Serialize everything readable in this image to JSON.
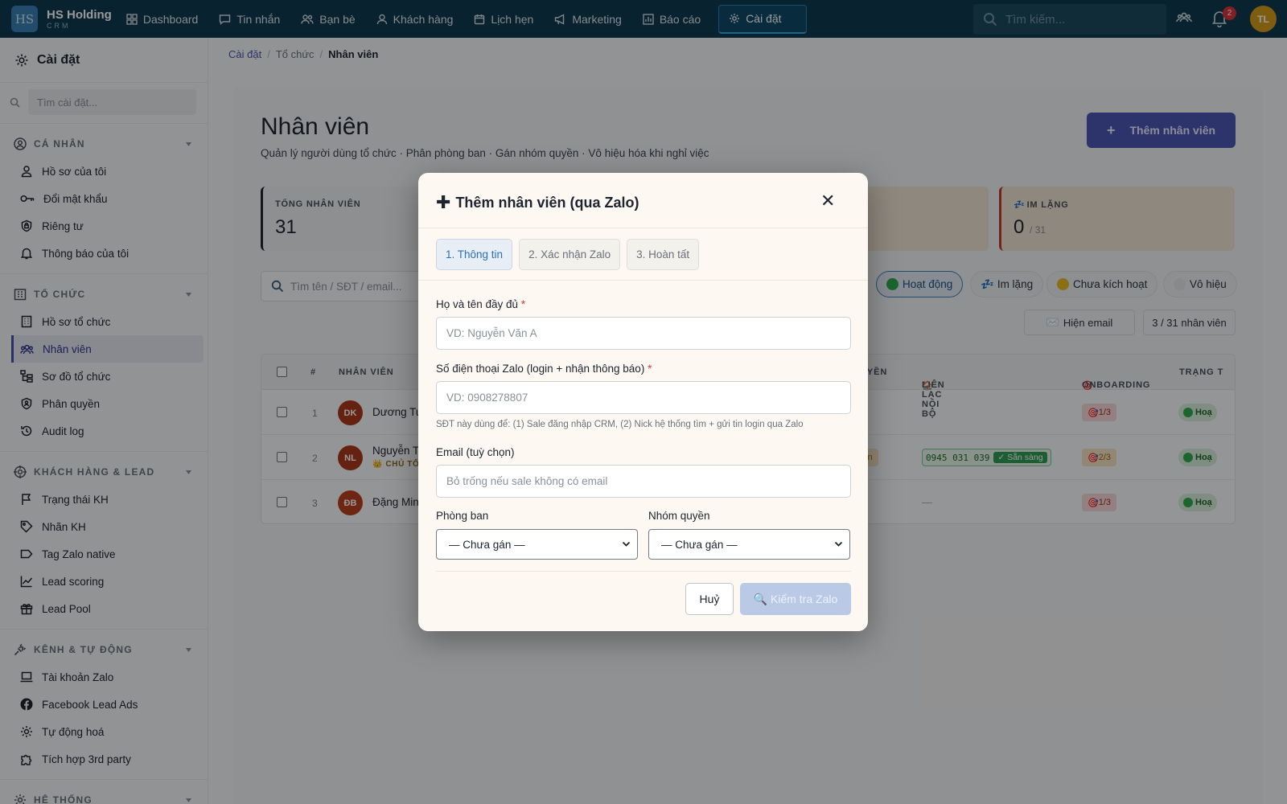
{
  "app": {
    "logo_mark": "HS",
    "name": "HS Holding",
    "sub": "CRM"
  },
  "nav": [
    {
      "label": "Dashboard",
      "icon": "grid-icon"
    },
    {
      "label": "Tin nhắn",
      "icon": "chat-icon"
    },
    {
      "label": "Bạn bè",
      "icon": "friends-icon"
    },
    {
      "label": "Khách hàng",
      "icon": "user-icon"
    },
    {
      "label": "Lịch hẹn",
      "icon": "calendar-icon"
    },
    {
      "label": "Marketing",
      "icon": "megaphone-icon"
    },
    {
      "label": "Báo cáo",
      "icon": "chart-icon"
    },
    {
      "label": "Cài đặt",
      "icon": "gear-icon",
      "active": true
    }
  ],
  "top": {
    "search_placeholder": "Tìm kiếm...",
    "notif_count": "2",
    "avatar": "TL"
  },
  "sidebar": {
    "title": "Cài đặt",
    "search_placeholder": "Tìm cài đặt...",
    "groups": [
      {
        "label": "CÁ NHÂN",
        "items": [
          "Hồ sơ của tôi",
          "Đổi mật khẩu",
          "Riêng tư",
          "Thông báo của tôi"
        ]
      },
      {
        "label": "TỔ CHỨC",
        "items": [
          "Hồ sơ tổ chức",
          "Nhân viên",
          "Sơ đồ tổ chức",
          "Phân quyền",
          "Audit log"
        ]
      },
      {
        "label": "KHÁCH HÀNG & LEAD",
        "items": [
          "Trạng thái KH",
          "Nhãn KH",
          "Tag Zalo native",
          "Lead scoring",
          "Lead Pool"
        ]
      },
      {
        "label": "KÊNH & TỰ ĐỘNG",
        "items": [
          "Tài khoản Zalo",
          "Facebook Lead Ads",
          "Tự động hoá",
          "Tích hợp 3rd party"
        ]
      },
      {
        "label": "HỆ THỐNG",
        "items": []
      }
    ]
  },
  "breadcrumb": [
    "Cài đặt",
    "Tổ chức",
    "Nhân viên"
  ],
  "page": {
    "title": "Nhân viên",
    "subtitle": "Quản lý người dùng tổ chức · Phân phòng ban · Gán nhóm quyền · Vô hiệu hóa khi nghỉ việc",
    "add_button": "Thêm nhân viên"
  },
  "stats": {
    "total_label": "TỔNG NHÂN VIÊN",
    "total_value": "31",
    "silent_label": "IM LẶNG",
    "silent_value": "0",
    "silent_of": "/ 31"
  },
  "filters": {
    "search_placeholder": "Tìm tên / SĐT / email...",
    "chips": [
      "Hoạt động",
      "Im lặng",
      "Chưa kích hoạt",
      "Vô hiệu"
    ],
    "show_email": "Hiện email",
    "count": "3 / 31 nhân viên"
  },
  "table": {
    "headers": {
      "num": "#",
      "employee": "NHÂN VIÊN",
      "role": "UYỀN",
      "contact": "LIÊN LẠC NỘI BỘ",
      "onboarding": "ONBOARDING",
      "status": "TRẠNG T"
    },
    "rows": [
      {
        "num": "1",
        "initials": "DK",
        "name": "Dương Tu",
        "tag": "",
        "role_tag": "",
        "contact": "—",
        "onboarding": "1/3",
        "status": "Hoạ",
        "color": "#a83a1c"
      },
      {
        "num": "2",
        "initials": "NL",
        "name": "Nguyễn T",
        "tag": "👑 CHỦ TỔ",
        "role_tag": "in",
        "contact_phone": "0945 031 039",
        "contact_ok": "✓ Sẵn sàng",
        "onboarding": "2/3",
        "status": "Hoạ",
        "color": "#a83a1c"
      },
      {
        "num": "3",
        "initials": "ĐB",
        "name": "Đặng Min",
        "tag": "",
        "role_tag": "",
        "contact": "—",
        "onboarding": "1/3",
        "status": "Hoạ",
        "color": "#b8401e"
      }
    ]
  },
  "modal": {
    "title": "Thêm nhân viên (qua Zalo)",
    "steps": [
      "1. Thông tin",
      "2. Xác nhận Zalo",
      "3. Hoàn tất"
    ],
    "name_label": "Họ và tên đầy đủ",
    "name_placeholder": "VD: Nguyễn Văn A",
    "phone_label": "Số điện thoại Zalo (login + nhận thông báo)",
    "phone_placeholder": "VD: 0908278807",
    "phone_hint": "SĐT này dùng để: (1) Sale đăng nhập CRM, (2) Nick hệ thống tìm + gửi tin login qua Zalo",
    "email_label": "Email (tuỳ chọn)",
    "email_placeholder": "Bỏ trống nếu sale không có email",
    "dept_label": "Phòng ban",
    "dept_value": "— Chưa gán —",
    "group_label": "Nhóm quyền",
    "group_value": "— Chưa gán —",
    "cancel": "Huỷ",
    "check": "🔍 Kiểm tra Zalo"
  },
  "colors": {
    "topbar": "#0f3a50",
    "accent": "#4b55b3",
    "active_step": "#2a6fb8"
  }
}
